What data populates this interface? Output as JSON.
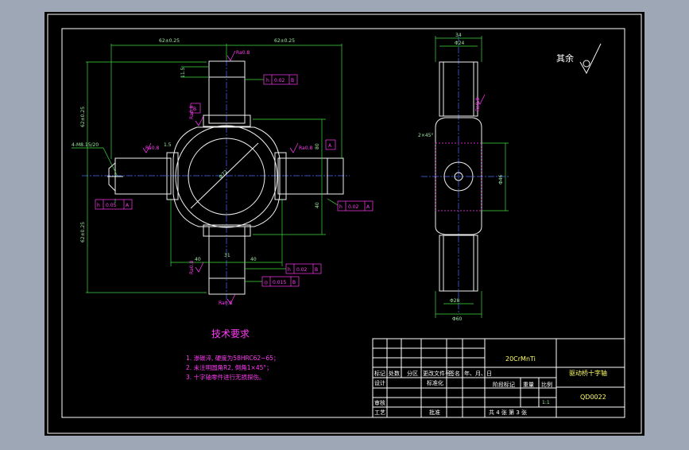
{
  "drawing": {
    "tech_title": "技术要求",
    "tech_notes": [
      "1. 渗碳淬, 硬度为58HRC62~65；",
      "2. 未注明圆角R2, 倒角1×45°；",
      "3. 十字轴零件进行无损探伤。"
    ],
    "material": "20CrMnTi",
    "part_name": "驱动桥十字轴",
    "drawing_no": "QD0022",
    "scale": "1:1",
    "sheet": "共 4 张   第 3 张",
    "roughness_other": "其余",
    "title_block": {
      "row_labels": [
        "标记",
        "处数",
        "分区",
        "更改文件号",
        "签名",
        "年、月、日"
      ],
      "design": "设计",
      "standardize": "标准化",
      "stage_mark": "阶段标记",
      "weight": "重量",
      "ratio": "比例",
      "check": "审核",
      "process": "工艺",
      "approve": "批准"
    },
    "dimensions": {
      "top_left_width": "62±0.25",
      "top_right_width": "62±0.25",
      "left_upper_height": "62±0.25",
      "left_lower_height": "62±0.25",
      "hole_callout": "4-M8.15/20",
      "circle_dia": "Φ72",
      "d1": "1.5",
      "d2": "80",
      "d3": "40",
      "d4": "40",
      "d5": "31",
      "d6": "31",
      "d7": "11.5",
      "side_top": "34",
      "side_top2": "Φ24",
      "side_chamfer": "2×45°",
      "side_bottom": "Φ28",
      "side_bottom2": "Φ60",
      "side_right": "Φ46"
    },
    "tolerances": [
      {
        "sym": "h",
        "val": "0.02",
        "ref": "B"
      },
      {
        "sym": "h",
        "val": "0.05",
        "ref": "A"
      },
      {
        "sym": "h",
        "val": "0.02",
        "ref": "A"
      },
      {
        "sym": "h",
        "val": "0.02",
        "ref": "B"
      },
      {
        "sym": "◎",
        "val": "0.015",
        "ref": "B"
      }
    ],
    "roughness": [
      "Ra0.8",
      "Ra0.8",
      "Ra0.8",
      "Ra0.8",
      "Ra0.8",
      "Ra0.8",
      "Ra0.8"
    ],
    "datum_a": "A",
    "datum_b": "B"
  }
}
